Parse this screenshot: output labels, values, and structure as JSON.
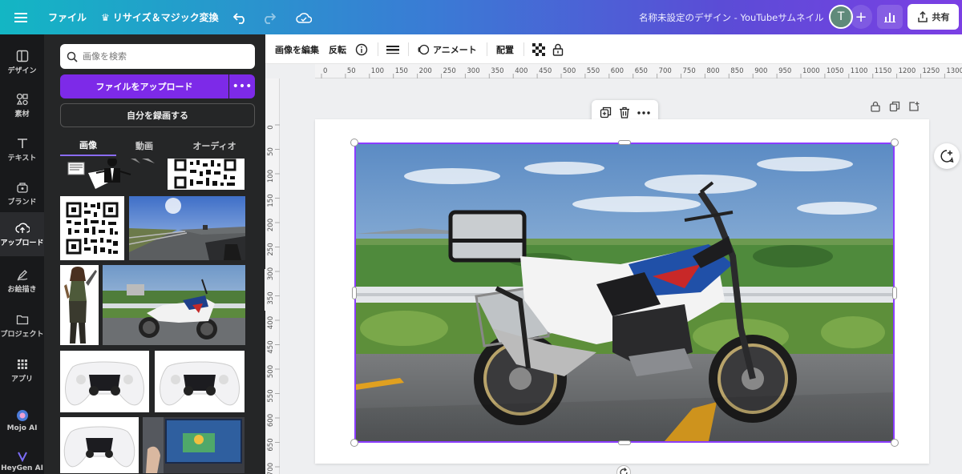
{
  "topbar": {
    "menu_icon": "hamburger-icon",
    "file_label": "ファイル",
    "resize_label": "♛ リサイズ＆マジック変換",
    "undo_icon": "undo-icon",
    "redo_icon": "redo-icon",
    "cloud_icon": "cloud-check-icon",
    "doc_title": "名称未設定のデザイン - YouTubeサムネイル",
    "avatar_initial": "T",
    "add_icon": "plus-icon",
    "insights_icon": "bar-chart-icon",
    "share_label": "共有",
    "gradient_colors": [
      "#13b6c4",
      "#3a7bd5",
      "#7b3fe4"
    ]
  },
  "rail": {
    "items": [
      {
        "label": "デザイン",
        "icon": "layout-icon"
      },
      {
        "label": "素材",
        "icon": "shapes-icon"
      },
      {
        "label": "テキスト",
        "icon": "text-icon"
      },
      {
        "label": "ブランド",
        "icon": "brand-icon"
      },
      {
        "label": "アップロード",
        "icon": "upload-cloud-icon",
        "active": true
      },
      {
        "label": "お絵描き",
        "icon": "draw-icon"
      },
      {
        "label": "プロジェクト",
        "icon": "folder-icon"
      },
      {
        "label": "アプリ",
        "icon": "apps-grid-icon"
      },
      {
        "label": "Mojo AI",
        "icon": "mojo-ai-icon"
      },
      {
        "label": "HeyGen AI",
        "icon": "heygen-ai-icon"
      }
    ]
  },
  "panel": {
    "search_placeholder": "画像を検索",
    "upload_label": "ファイルをアップロード",
    "more_label": "•••",
    "record_label": "自分を録画する",
    "tabs": [
      {
        "label": "画像",
        "active": true
      },
      {
        "label": "動画",
        "active": false
      },
      {
        "label": "オーディオ",
        "active": false
      }
    ],
    "collapse_label": "‹",
    "accent": "#7d2ae8"
  },
  "context_toolbar": {
    "edit_image": "画像を編集",
    "flip": "反転",
    "info_icon": "info-icon",
    "border_icon": "border-style-icon",
    "animate": "アニメート",
    "position": "配置",
    "transparency_icon": "transparency-icon",
    "lock_icon": "lock-icon"
  },
  "ruler": {
    "h_ticks": [
      "0",
      "50",
      "100",
      "150",
      "200",
      "250",
      "300",
      "350",
      "400",
      "450",
      "500",
      "550",
      "600",
      "650",
      "700",
      "750",
      "800",
      "850",
      "900",
      "950",
      "1000",
      "1050",
      "1100",
      "1150",
      "1200",
      "1250",
      "1300"
    ],
    "v_ticks": [
      "0",
      "50",
      "100",
      "150",
      "200",
      "250",
      "300",
      "350",
      "400",
      "450",
      "500",
      "550",
      "600",
      "650",
      "700"
    ]
  },
  "canvas": {
    "selection_color": "#8b3dff",
    "float_toolbar": {
      "duplicate_icon": "duplicate-icon",
      "delete_icon": "trash-icon",
      "more_icon": "more-horizontal-icon"
    },
    "page_icons": [
      "lock-icon",
      "copy-page-icon",
      "add-page-icon"
    ],
    "comment_icon": "add-comment-icon",
    "rotate_icon": "rotate-icon"
  }
}
